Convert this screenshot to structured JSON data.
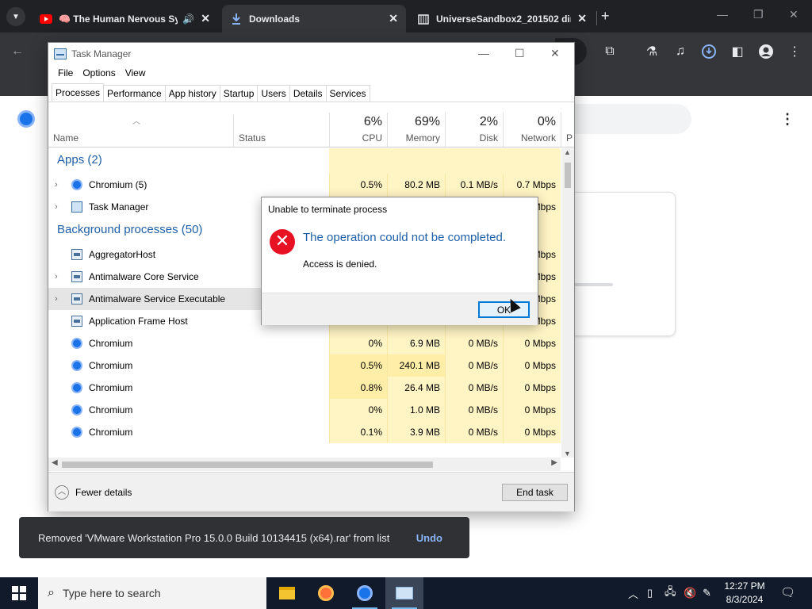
{
  "browser": {
    "tabs": [
      {
        "title": "🧠 The Human Nervous Sy",
        "icon": "youtube-icon",
        "audio": true
      },
      {
        "title": "Downloads",
        "icon": "download-icon"
      },
      {
        "title": "UniverseSandbox2_201502 dir",
        "icon": "archive-icon"
      }
    ],
    "close_glyph": "✕",
    "newtab_glyph": "+"
  },
  "snackbar": {
    "message": "Removed 'VMware Workstation Pro 15.0.0 Build 10134415 (x64).rar' from list",
    "undo": "Undo"
  },
  "taskmgr": {
    "title": "Task Manager",
    "menu": [
      "File",
      "Options",
      "View"
    ],
    "tabs": [
      "Processes",
      "Performance",
      "App history",
      "Startup",
      "Users",
      "Details",
      "Services"
    ],
    "columns": {
      "name": "Name",
      "status": "Status",
      "cpu": {
        "pct": "6%",
        "label": "CPU"
      },
      "memory": {
        "pct": "69%",
        "label": "Memory"
      },
      "disk": {
        "pct": "2%",
        "label": "Disk"
      },
      "network": {
        "pct": "0%",
        "label": "Network"
      },
      "power": "P"
    },
    "groups": {
      "apps": "Apps (2)",
      "background": "Background processes (50)"
    },
    "rows": [
      {
        "name": "Chromium (5)",
        "cpu": "0.5%",
        "mem": "80.2 MB",
        "disk": "0.1 MB/s",
        "net": "0.7 Mbps"
      },
      {
        "name": "Task Manager",
        "cpu": "",
        "mem": "",
        "disk": "",
        "net": "Mbps"
      },
      {
        "name": "AggregatorHost",
        "cpu": "",
        "mem": "",
        "disk": "",
        "net": "Mbps"
      },
      {
        "name": "Antimalware Core Service",
        "cpu": "",
        "mem": "",
        "disk": "",
        "net": "Mbps"
      },
      {
        "name": "Antimalware Service Executable",
        "cpu": "",
        "mem": "",
        "disk": "",
        "net": "Mbps"
      },
      {
        "name": "Application Frame Host",
        "cpu": "0%",
        "mem": "1.9 MB",
        "disk": "0 MB/s",
        "net": "0 Mbps"
      },
      {
        "name": "Chromium",
        "cpu": "0%",
        "mem": "6.9 MB",
        "disk": "0 MB/s",
        "net": "0 Mbps"
      },
      {
        "name": "Chromium",
        "cpu": "0.5%",
        "mem": "240.1 MB",
        "disk": "0 MB/s",
        "net": "0 Mbps"
      },
      {
        "name": "Chromium",
        "cpu": "0.8%",
        "mem": "26.4 MB",
        "disk": "0 MB/s",
        "net": "0 Mbps"
      },
      {
        "name": "Chromium",
        "cpu": "0%",
        "mem": "1.0 MB",
        "disk": "0 MB/s",
        "net": "0 Mbps"
      },
      {
        "name": "Chromium",
        "cpu": "0.1%",
        "mem": "3.9 MB",
        "disk": "0 MB/s",
        "net": "0 Mbps"
      }
    ],
    "fewer_details": "Fewer details",
    "end_task": "End task"
  },
  "dialog": {
    "title": "Unable to terminate process",
    "main": "The operation could not be completed.",
    "sub": "Access is denied.",
    "ok": "OK",
    "error_glyph": "✕"
  },
  "taskbar": {
    "search_placeholder": "Type here to search",
    "time": "12:27 PM",
    "date": "8/3/2024"
  },
  "colors": {
    "accent": "#0078d7",
    "error": "#e81123",
    "heat": "#fff4c4",
    "link": "#8ab4f8"
  }
}
